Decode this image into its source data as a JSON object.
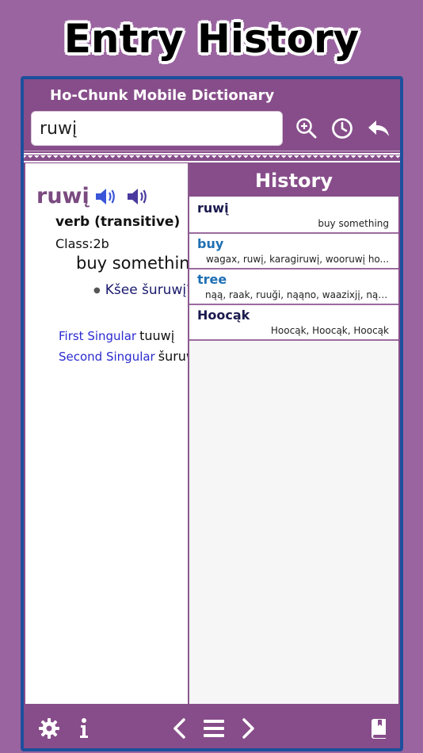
{
  "promo": {
    "title": "Entry History"
  },
  "app": {
    "title": "Ho-Chunk Mobile Dictionary"
  },
  "search": {
    "value": "ruwį"
  },
  "entry": {
    "headword": "ruwį",
    "part_of_speech": "verb (transitive)",
    "class": "Class:2b",
    "gloss": "buy something",
    "example": "Kšee šuruwį?",
    "conjugations": [
      {
        "label": "First Singular",
        "value": "tuuwį"
      },
      {
        "label": "Second Singular",
        "value": "šuruwį"
      }
    ]
  },
  "history": {
    "title": "History",
    "items": [
      {
        "word": "ruwį",
        "detail": "buy something",
        "color": "#1a1a4e"
      },
      {
        "word": "buy",
        "detail": "wagax, ruwį, karagiruwį, wooruwį ho...",
        "color": "#1e6fb4"
      },
      {
        "word": "tree",
        "detail": "nąą, raak, ruuği, nąąno, waazixjį, nąą...",
        "color": "#1e6fb4"
      },
      {
        "word": "Hoocąk",
        "detail": "Hoocąk, Hoocąk, Hoocąk",
        "color": "#1a1a4e"
      }
    ]
  },
  "colors": {
    "accent": "#874d8a",
    "frame": "#1c4f9c",
    "background": "#9a64a0"
  },
  "icons": {
    "header": [
      "zoom-in-icon",
      "clock-icon",
      "back-arrow-icon"
    ],
    "footer": [
      "gear-icon",
      "info-icon",
      "chevron-left-icon",
      "menu-icon",
      "chevron-right-icon",
      "book-icon"
    ]
  }
}
